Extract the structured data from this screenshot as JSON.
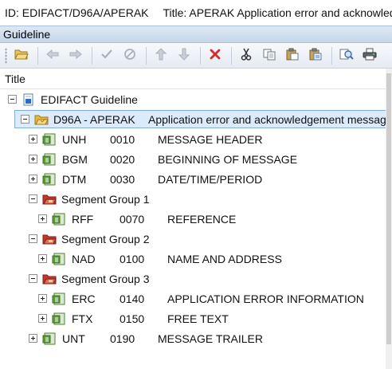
{
  "window": {
    "id_text": "ID: EDIFACT/D96A/APERAK",
    "title_text": "Title: APERAK Application error and acknowledgement message"
  },
  "panel": {
    "title": "Guideline"
  },
  "toolbar": {
    "buttons": [
      {
        "name": "open-folder-icon",
        "enabled": true
      },
      {
        "name": "back-arrow-icon",
        "enabled": false
      },
      {
        "name": "forward-arrow-icon",
        "enabled": false
      },
      {
        "name": "checkmark-icon",
        "enabled": false
      },
      {
        "name": "cancel-circle-icon",
        "enabled": false
      },
      {
        "name": "move-up-icon",
        "enabled": false
      },
      {
        "name": "move-down-icon",
        "enabled": false
      },
      {
        "name": "delete-icon",
        "enabled": true
      },
      {
        "name": "cut-icon",
        "enabled": true
      },
      {
        "name": "copy-icon",
        "enabled": true
      },
      {
        "name": "paste-icon",
        "enabled": true
      },
      {
        "name": "paste-special-icon",
        "enabled": true
      },
      {
        "name": "preview-icon",
        "enabled": true
      },
      {
        "name": "print-icon",
        "enabled": true
      }
    ]
  },
  "columns": {
    "title": "Title"
  },
  "tree": {
    "root": {
      "label": "EDIFACT Guideline",
      "expanded": true
    },
    "message": {
      "code": "D96A - APERAK",
      "description": "Application error and acknowledgement message",
      "expanded": true,
      "selected": true
    },
    "items": [
      {
        "kind": "segment",
        "level": 2,
        "tag": "UNH",
        "pos": "0010",
        "desc": "MESSAGE HEADER"
      },
      {
        "kind": "segment",
        "level": 2,
        "tag": "BGM",
        "pos": "0020",
        "desc": "BEGINNING OF MESSAGE"
      },
      {
        "kind": "segment",
        "level": 2,
        "tag": "DTM",
        "pos": "0030",
        "desc": "DATE/TIME/PERIOD"
      },
      {
        "kind": "group",
        "level": 2,
        "label": "Segment Group 1"
      },
      {
        "kind": "segment",
        "level": 3,
        "tag": "RFF",
        "pos": "0070",
        "desc": "REFERENCE"
      },
      {
        "kind": "group",
        "level": 2,
        "label": "Segment Group 2"
      },
      {
        "kind": "segment",
        "level": 3,
        "tag": "NAD",
        "pos": "0100",
        "desc": "NAME AND ADDRESS"
      },
      {
        "kind": "group",
        "level": 2,
        "label": "Segment Group 3"
      },
      {
        "kind": "segment",
        "level": 3,
        "tag": "ERC",
        "pos": "0140",
        "desc": "APPLICATION ERROR INFORMATION"
      },
      {
        "kind": "segment",
        "level": 3,
        "tag": "FTX",
        "pos": "0150",
        "desc": "FREE TEXT"
      },
      {
        "kind": "segment",
        "level": 2,
        "tag": "UNT",
        "pos": "0190",
        "desc": "MESSAGE TRAILER"
      }
    ]
  },
  "colors": {
    "selection_fill": "#dcebfc",
    "selection_border": "#84acdd",
    "segment_icon": "#5a9a3a",
    "group_icon": "#c0392b",
    "message_icon": "#e7b73c"
  }
}
